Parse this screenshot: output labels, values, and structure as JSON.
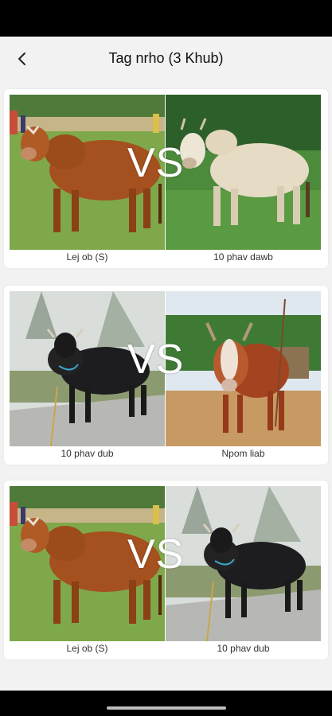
{
  "header": {
    "title": "Tag nrho (3 Khub)",
    "back_icon": "chevron-left-icon"
  },
  "vs_label": "VS",
  "matches": [
    {
      "left": {
        "name": "Lej ob (S)",
        "image": "brown-zebu-bull-photo"
      },
      "right": {
        "name": "10 phav dawb",
        "image": "white-zebu-bull-photo"
      }
    },
    {
      "left": {
        "name": "10 phav dub",
        "image": "black-bull-photo"
      },
      "right": {
        "name": "Npom liab",
        "image": "red-white-faced-bull-photo"
      }
    },
    {
      "left": {
        "name": "Lej ob (S)",
        "image": "brown-zebu-bull-photo"
      },
      "right": {
        "name": "10 phav dub",
        "image": "black-bull-photo"
      }
    }
  ],
  "colors": {
    "background": "#f2f2f2",
    "card": "#ffffff",
    "text": "#111111",
    "bars": "#000000"
  }
}
